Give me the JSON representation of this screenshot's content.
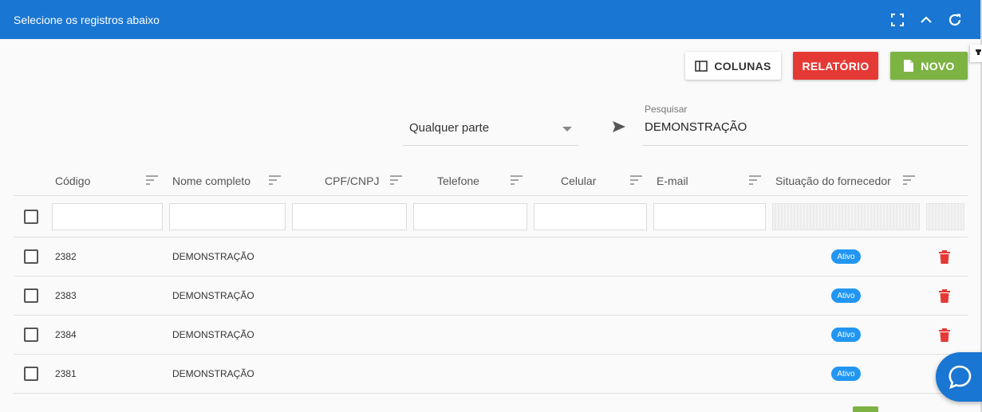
{
  "header": {
    "title": "Selecione os registros abaixo",
    "icons": [
      "fullscreen-icon",
      "chevron-up-icon",
      "refresh-icon"
    ]
  },
  "toolbar": {
    "columns_label": "COLUNAS",
    "report_label": "RELATÓRIO",
    "new_label": "NOVO"
  },
  "search": {
    "mode_value": "Qualquer parte",
    "label": "Pesquisar",
    "value": "DEMONSTRAÇÃO"
  },
  "table": {
    "columns": [
      "Código",
      "Nome completo",
      "CPF/CNPJ",
      "Telefone",
      "Celular",
      "E-mail",
      "Situação do fornecedor"
    ],
    "rows": [
      {
        "code": "2382",
        "name": "DEMONSTRAÇÃO",
        "status": "Ativo"
      },
      {
        "code": "2383",
        "name": "DEMONSTRAÇÃO",
        "status": "Ativo"
      },
      {
        "code": "2384",
        "name": "DEMONSTRAÇÃO",
        "status": "Ativo"
      },
      {
        "code": "2381",
        "name": "DEMONSTRAÇÃO",
        "status": "Ativo"
      }
    ]
  },
  "colors": {
    "header_bg": "#1976d2",
    "report_bg": "#e53935",
    "new_bg": "#7cb342",
    "badge_bg": "#2196f3",
    "trash": "#e53935"
  }
}
